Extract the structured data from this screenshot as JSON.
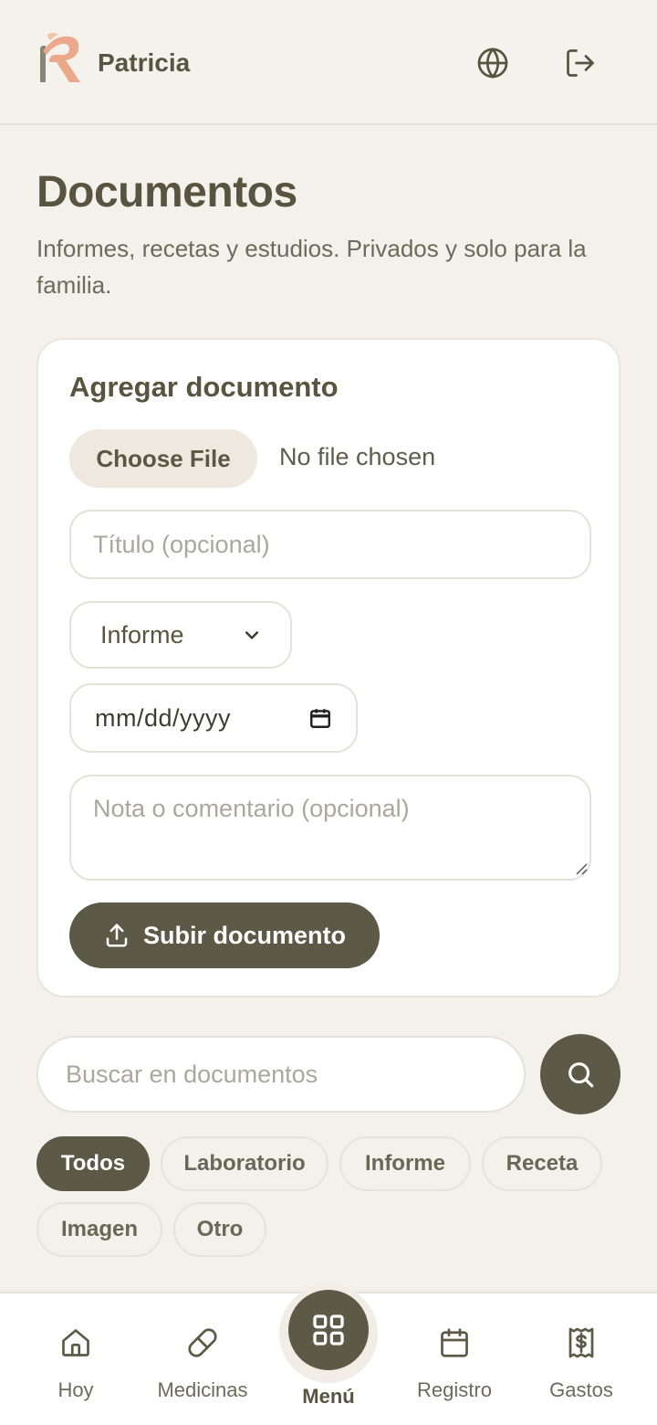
{
  "header": {
    "user_name": "Patricia",
    "icons": {
      "language": "globe-icon",
      "logout": "logout-icon"
    }
  },
  "page": {
    "title": "Documentos",
    "subtitle": "Informes, recetas y estudios. Privados y solo para la familia."
  },
  "add_form": {
    "title": "Agregar documento",
    "file_button": "Choose File",
    "file_status": "No file chosen",
    "title_placeholder": "Título (opcional)",
    "type_selected": "Informe",
    "date_placeholder": "mm/dd/yyyy",
    "note_placeholder": "Nota o comentario (opcional)",
    "upload_label": "Subir documento"
  },
  "search": {
    "placeholder": "Buscar en documentos"
  },
  "filters": [
    {
      "label": "Todos",
      "active": true
    },
    {
      "label": "Laboratorio",
      "active": false
    },
    {
      "label": "Informe",
      "active": false
    },
    {
      "label": "Receta",
      "active": false
    },
    {
      "label": "Imagen",
      "active": false
    },
    {
      "label": "Otro",
      "active": false
    }
  ],
  "bottom_nav": {
    "items": [
      {
        "label": "Hoy",
        "icon": "home-icon"
      },
      {
        "label": "Medicinas",
        "icon": "pill-icon"
      },
      {
        "label": "Menú",
        "icon": "grid-icon"
      },
      {
        "label": "Registro",
        "icon": "calendar-icon"
      },
      {
        "label": "Gastos",
        "icon": "receipt-icon"
      }
    ]
  },
  "colors": {
    "background": "#f4f1ec",
    "primary": "#5c5946",
    "text": "#57543f",
    "logo_accent": "#e9a98a"
  }
}
